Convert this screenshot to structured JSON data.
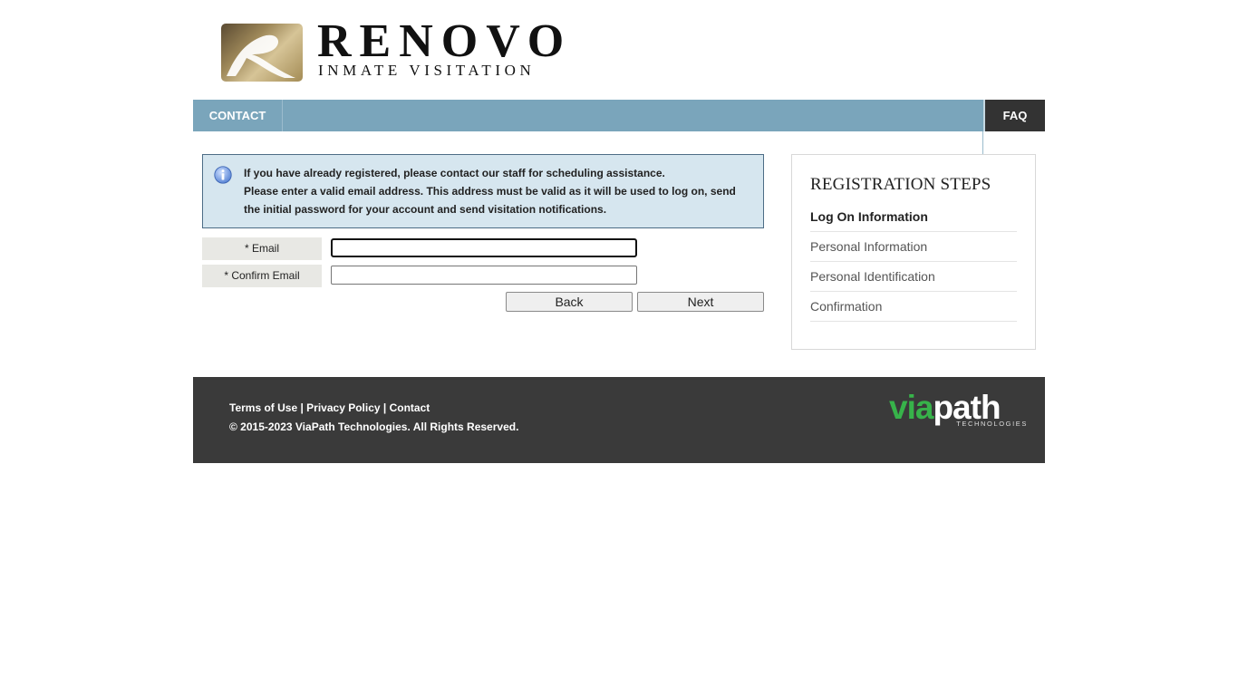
{
  "brand": {
    "title": "RENOVO",
    "subtitle": "INMATE VISITATION"
  },
  "nav": {
    "contact": "CONTACT",
    "faq": "FAQ"
  },
  "info": {
    "line1": "If you have already registered, please contact our staff for scheduling assistance.",
    "line2": "Please enter a valid email address. This address must be valid as it will be used to log on, send the initial password for your account and send visitation notifications."
  },
  "form": {
    "email_label": "* Email",
    "email_value": "",
    "confirm_label": "* Confirm Email",
    "confirm_value": "",
    "back": "Back",
    "next": "Next"
  },
  "steps": {
    "title": "REGISTRATION STEPS",
    "items": [
      {
        "label": "Log On Information",
        "active": true
      },
      {
        "label": "Personal Information",
        "active": false
      },
      {
        "label": "Personal Identification",
        "active": false
      },
      {
        "label": "Confirmation",
        "active": false
      }
    ]
  },
  "footer": {
    "terms": "Terms of Use",
    "privacy": "Privacy Policy",
    "contact": "Contact",
    "separator": " | ",
    "copyright": "© 2015-2023 ViaPath Technologies. All Rights Reserved.",
    "logo_via": "via",
    "logo_path": "path",
    "logo_tagline": "TECHNOLOGIES"
  },
  "colors": {
    "nav_bg": "#7aa5bb",
    "faq_bg": "#333333",
    "info_bg": "#d6e6ef",
    "footer_bg": "#3a3a3a",
    "viapath_green": "#37b34a"
  }
}
